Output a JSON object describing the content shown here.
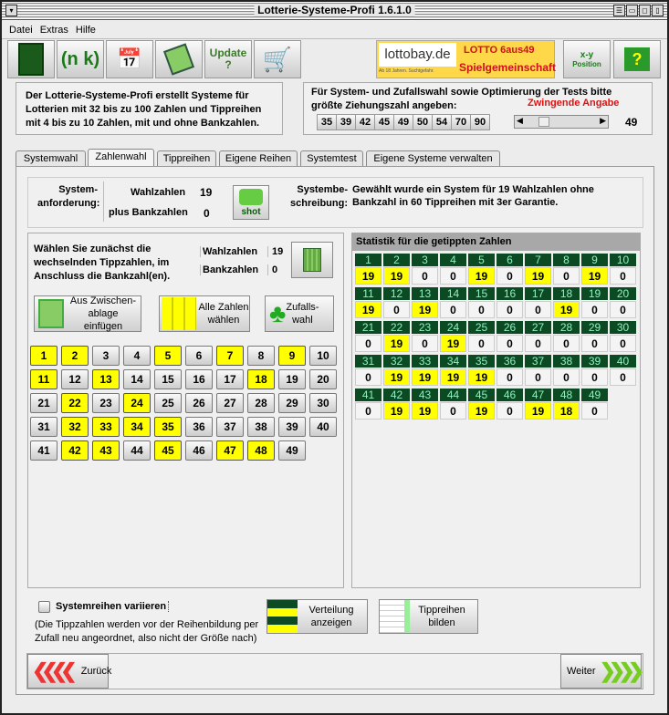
{
  "window": {
    "title": "Lotterie-Systeme-Profi 1.6.1.0"
  },
  "menu": [
    "Datei",
    "Extras",
    "Hilfe"
  ],
  "toolbar": {
    "update_label": "Update ?",
    "ad_brand": "lottobay.de",
    "ad_warning": "Ab 18 Jahren. Suchtgefahr.",
    "ad_lotto": "LOTTO 6aus49",
    "ad_spiel": "Spielgemeinschaft",
    "position_label": "Position",
    "xy_label": "x-y",
    "nk_label": "(n k)"
  },
  "info": {
    "text": "Der Lotterie-Systeme-Profi erstellt Systeme für Lotterien mit 32 bis zu 100 Zahlen und Tippreihen mit 4 bis zu 10 Zahlen, mit und ohne Bankzahlen."
  },
  "ziehung": {
    "text": "Für System- und Zufallswahl sowie Optimierung der Tests bitte größte Ziehungszahl angeben:",
    "required": "Zwingende Angabe",
    "presets": [
      "35",
      "39",
      "42",
      "45",
      "49",
      "50",
      "54",
      "70",
      "90"
    ],
    "value": "49",
    "slider_fraction": 0.17
  },
  "tabs": [
    "Systemwahl",
    "Zahlenwahl",
    "Tippreihen",
    "Eigene Reihen",
    "Systemtest",
    "Eigene Systeme verwalten"
  ],
  "active_tab": "Zahlenwahl",
  "requirement": {
    "label": "System-\nanforderung:",
    "wahl_label": "Wahlzahlen",
    "wahl_value": "19",
    "bank_label": "plus Bankzahlen",
    "bank_value": "0",
    "shot_label": "shot",
    "desc_label": "Systembe-\nschreibung:",
    "desc": "Gewählt wurde ein System für 19 Wahlzahlen ohne Bankzahl in 60 Tippreihen mit 3er Garantie."
  },
  "selection": {
    "hint": "Wählen Sie zunächst die wechselnden Tippzahlen, im Anschluss die Bankzahl(en).",
    "wahl_label": "Wahlzahlen",
    "wahl_value": "19",
    "bank_label": "Bankzahlen",
    "bank_value": "0",
    "paste_label": "Aus Zwischen-ablage einfügen",
    "all_label": "Alle Zahlen wählen",
    "random_label": "Zufalls-wahl"
  },
  "numbers": {
    "max": 49,
    "selected": [
      1,
      2,
      5,
      7,
      9,
      11,
      13,
      18,
      22,
      24,
      32,
      33,
      34,
      35,
      42,
      43,
      45,
      47,
      48
    ]
  },
  "statistics": {
    "title": "Statistik für die getippten Zahlen",
    "counts": [
      19,
      19,
      0,
      0,
      19,
      0,
      19,
      0,
      19,
      0,
      19,
      0,
      19,
      0,
      0,
      0,
      0,
      19,
      0,
      0,
      0,
      19,
      0,
      19,
      0,
      0,
      0,
      0,
      0,
      0,
      0,
      19,
      19,
      19,
      19,
      0,
      0,
      0,
      0,
      0,
      0,
      19,
      19,
      0,
      19,
      0,
      19,
      18,
      0
    ]
  },
  "bottom": {
    "vary_label": "Systemreihen variieren",
    "vary_checked": false,
    "vary_note": "(Die Tippzahlen werden vor der Reihenbildung per Zufall neu angeordnet, also nicht der Größe nach)",
    "dist_label": "Verteilung anzeigen",
    "build_label": "Tippreihen bilden",
    "back_label": "Zurück",
    "next_label": "Weiter"
  }
}
